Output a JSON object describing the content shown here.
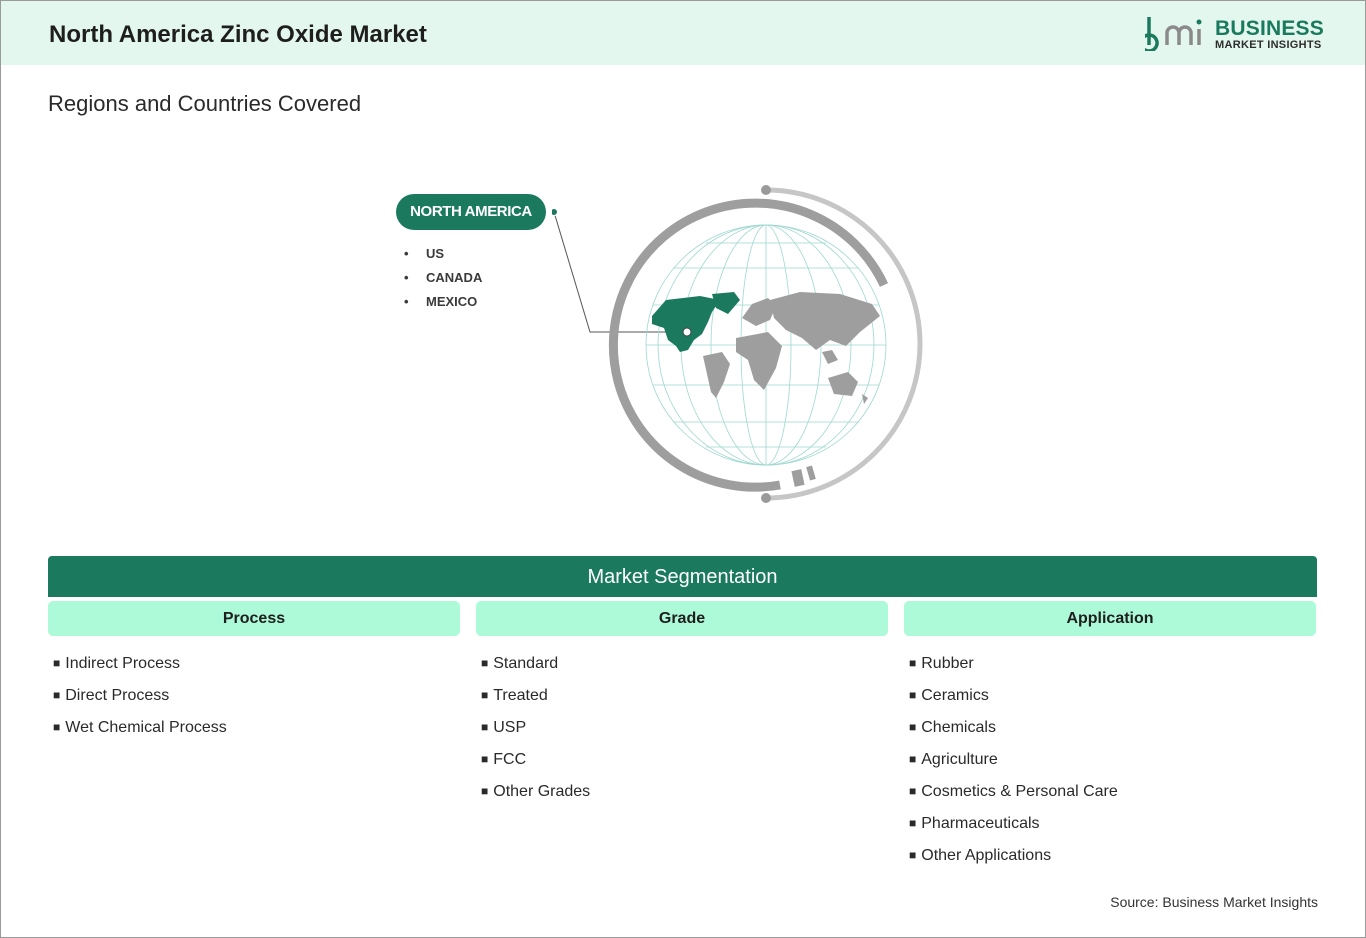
{
  "header": {
    "title": "North America Zinc Oxide Market",
    "logo_mark": "bmi",
    "logo_line1": "BUSINESS",
    "logo_line2": "MARKET INSIGHTS"
  },
  "regions": {
    "subtitle": "Regions and Countries Covered",
    "region_label": "NORTH AMERICA",
    "countries": [
      "US",
      "CANADA",
      "MEXICO"
    ]
  },
  "segmentation": {
    "title": "Market Segmentation",
    "columns": [
      {
        "heading": "Process",
        "items": [
          "Indirect Process",
          "Direct Process",
          "Wet Chemical Process"
        ]
      },
      {
        "heading": "Grade",
        "items": [
          "Standard",
          "Treated",
          "USP",
          "FCC",
          "Other Grades"
        ]
      },
      {
        "heading": "Application",
        "items": [
          "Rubber",
          "Ceramics",
          "Chemicals",
          "Agriculture",
          "Cosmetics & Personal Care",
          "Pharmaceuticals",
          "Other Applications"
        ]
      }
    ]
  },
  "footer": {
    "source": "Source: Business Market Insights"
  },
  "colors": {
    "brand_green": "#1b7a5e",
    "header_bg": "#e3f7ee",
    "column_head_bg": "#adfad9",
    "map_grey": "#9e9e9e"
  },
  "bullet_glyph": "■"
}
